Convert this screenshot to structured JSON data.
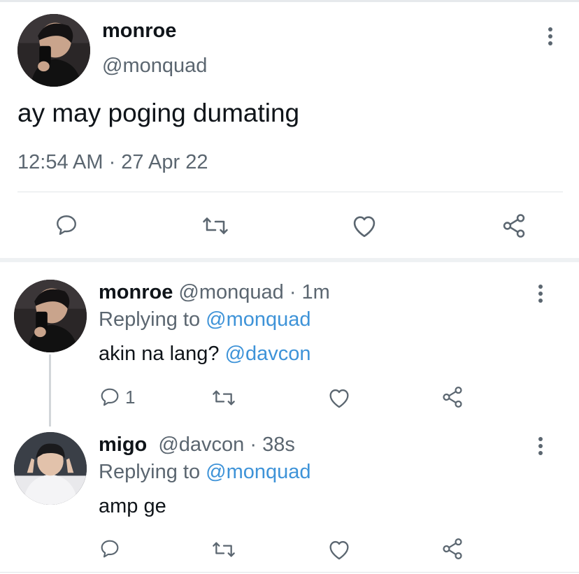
{
  "main_tweet": {
    "display_name": "monroe",
    "handle": "@monquad",
    "text": "ay may poging dumating",
    "timestamp": "12:54 AM · 27 Apr 22",
    "avatar_icon": "avatar-photo-man-with-phone"
  },
  "replies": [
    {
      "display_name": "monroe",
      "handle": "@monquad",
      "time": "· 1m",
      "replying_label": "Replying to",
      "replying_to": "@monquad",
      "text": "akin na lang?",
      "mention": "@davcon",
      "reply_count": "1",
      "avatar_icon": "avatar-photo-man-with-phone"
    },
    {
      "display_name": "migo",
      "handle": "@davcon",
      "time": "· 38s",
      "replying_label": "Replying to",
      "replying_to": "@monquad",
      "text": "amp ge",
      "avatar_icon": "avatar-photo-person-peace-sign"
    }
  ],
  "colors": {
    "text": "#0f1419",
    "muted": "#5b6670",
    "link": "#3e93d8",
    "divider": "#e1e5e8"
  }
}
